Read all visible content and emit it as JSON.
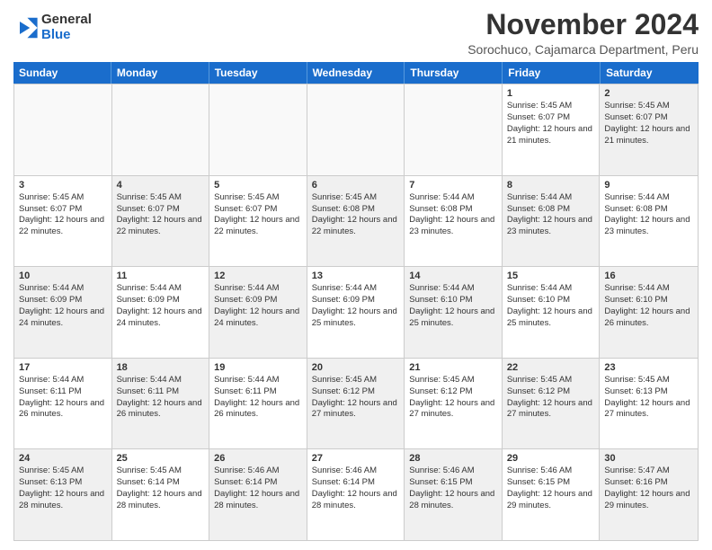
{
  "logo": {
    "general": "General",
    "blue": "Blue"
  },
  "title": "November 2024",
  "location": "Sorochuco, Cajamarca Department, Peru",
  "weekdays": [
    "Sunday",
    "Monday",
    "Tuesday",
    "Wednesday",
    "Thursday",
    "Friday",
    "Saturday"
  ],
  "rows": [
    [
      {
        "day": "",
        "info": "",
        "empty": true
      },
      {
        "day": "",
        "info": "",
        "empty": true
      },
      {
        "day": "",
        "info": "",
        "empty": true
      },
      {
        "day": "",
        "info": "",
        "empty": true
      },
      {
        "day": "",
        "info": "",
        "empty": true
      },
      {
        "day": "1",
        "info": "Sunrise: 5:45 AM\nSunset: 6:07 PM\nDaylight: 12 hours and 21 minutes."
      },
      {
        "day": "2",
        "info": "Sunrise: 5:45 AM\nSunset: 6:07 PM\nDaylight: 12 hours and 21 minutes.",
        "shaded": true
      }
    ],
    [
      {
        "day": "3",
        "info": "Sunrise: 5:45 AM\nSunset: 6:07 PM\nDaylight: 12 hours and 22 minutes."
      },
      {
        "day": "4",
        "info": "Sunrise: 5:45 AM\nSunset: 6:07 PM\nDaylight: 12 hours and 22 minutes.",
        "shaded": true
      },
      {
        "day": "5",
        "info": "Sunrise: 5:45 AM\nSunset: 6:07 PM\nDaylight: 12 hours and 22 minutes."
      },
      {
        "day": "6",
        "info": "Sunrise: 5:45 AM\nSunset: 6:08 PM\nDaylight: 12 hours and 22 minutes.",
        "shaded": true
      },
      {
        "day": "7",
        "info": "Sunrise: 5:44 AM\nSunset: 6:08 PM\nDaylight: 12 hours and 23 minutes."
      },
      {
        "day": "8",
        "info": "Sunrise: 5:44 AM\nSunset: 6:08 PM\nDaylight: 12 hours and 23 minutes.",
        "shaded": true
      },
      {
        "day": "9",
        "info": "Sunrise: 5:44 AM\nSunset: 6:08 PM\nDaylight: 12 hours and 23 minutes."
      }
    ],
    [
      {
        "day": "10",
        "info": "Sunrise: 5:44 AM\nSunset: 6:09 PM\nDaylight: 12 hours and 24 minutes.",
        "shaded": true
      },
      {
        "day": "11",
        "info": "Sunrise: 5:44 AM\nSunset: 6:09 PM\nDaylight: 12 hours and 24 minutes."
      },
      {
        "day": "12",
        "info": "Sunrise: 5:44 AM\nSunset: 6:09 PM\nDaylight: 12 hours and 24 minutes.",
        "shaded": true
      },
      {
        "day": "13",
        "info": "Sunrise: 5:44 AM\nSunset: 6:09 PM\nDaylight: 12 hours and 25 minutes."
      },
      {
        "day": "14",
        "info": "Sunrise: 5:44 AM\nSunset: 6:10 PM\nDaylight: 12 hours and 25 minutes.",
        "shaded": true
      },
      {
        "day": "15",
        "info": "Sunrise: 5:44 AM\nSunset: 6:10 PM\nDaylight: 12 hours and 25 minutes."
      },
      {
        "day": "16",
        "info": "Sunrise: 5:44 AM\nSunset: 6:10 PM\nDaylight: 12 hours and 26 minutes.",
        "shaded": true
      }
    ],
    [
      {
        "day": "17",
        "info": "Sunrise: 5:44 AM\nSunset: 6:11 PM\nDaylight: 12 hours and 26 minutes."
      },
      {
        "day": "18",
        "info": "Sunrise: 5:44 AM\nSunset: 6:11 PM\nDaylight: 12 hours and 26 minutes.",
        "shaded": true
      },
      {
        "day": "19",
        "info": "Sunrise: 5:44 AM\nSunset: 6:11 PM\nDaylight: 12 hours and 26 minutes."
      },
      {
        "day": "20",
        "info": "Sunrise: 5:45 AM\nSunset: 6:12 PM\nDaylight: 12 hours and 27 minutes.",
        "shaded": true
      },
      {
        "day": "21",
        "info": "Sunrise: 5:45 AM\nSunset: 6:12 PM\nDaylight: 12 hours and 27 minutes."
      },
      {
        "day": "22",
        "info": "Sunrise: 5:45 AM\nSunset: 6:12 PM\nDaylight: 12 hours and 27 minutes.",
        "shaded": true
      },
      {
        "day": "23",
        "info": "Sunrise: 5:45 AM\nSunset: 6:13 PM\nDaylight: 12 hours and 27 minutes."
      }
    ],
    [
      {
        "day": "24",
        "info": "Sunrise: 5:45 AM\nSunset: 6:13 PM\nDaylight: 12 hours and 28 minutes.",
        "shaded": true
      },
      {
        "day": "25",
        "info": "Sunrise: 5:45 AM\nSunset: 6:14 PM\nDaylight: 12 hours and 28 minutes."
      },
      {
        "day": "26",
        "info": "Sunrise: 5:46 AM\nSunset: 6:14 PM\nDaylight: 12 hours and 28 minutes.",
        "shaded": true
      },
      {
        "day": "27",
        "info": "Sunrise: 5:46 AM\nSunset: 6:14 PM\nDaylight: 12 hours and 28 minutes."
      },
      {
        "day": "28",
        "info": "Sunrise: 5:46 AM\nSunset: 6:15 PM\nDaylight: 12 hours and 28 minutes.",
        "shaded": true
      },
      {
        "day": "29",
        "info": "Sunrise: 5:46 AM\nSunset: 6:15 PM\nDaylight: 12 hours and 29 minutes."
      },
      {
        "day": "30",
        "info": "Sunrise: 5:47 AM\nSunset: 6:16 PM\nDaylight: 12 hours and 29 minutes.",
        "shaded": true
      }
    ]
  ]
}
